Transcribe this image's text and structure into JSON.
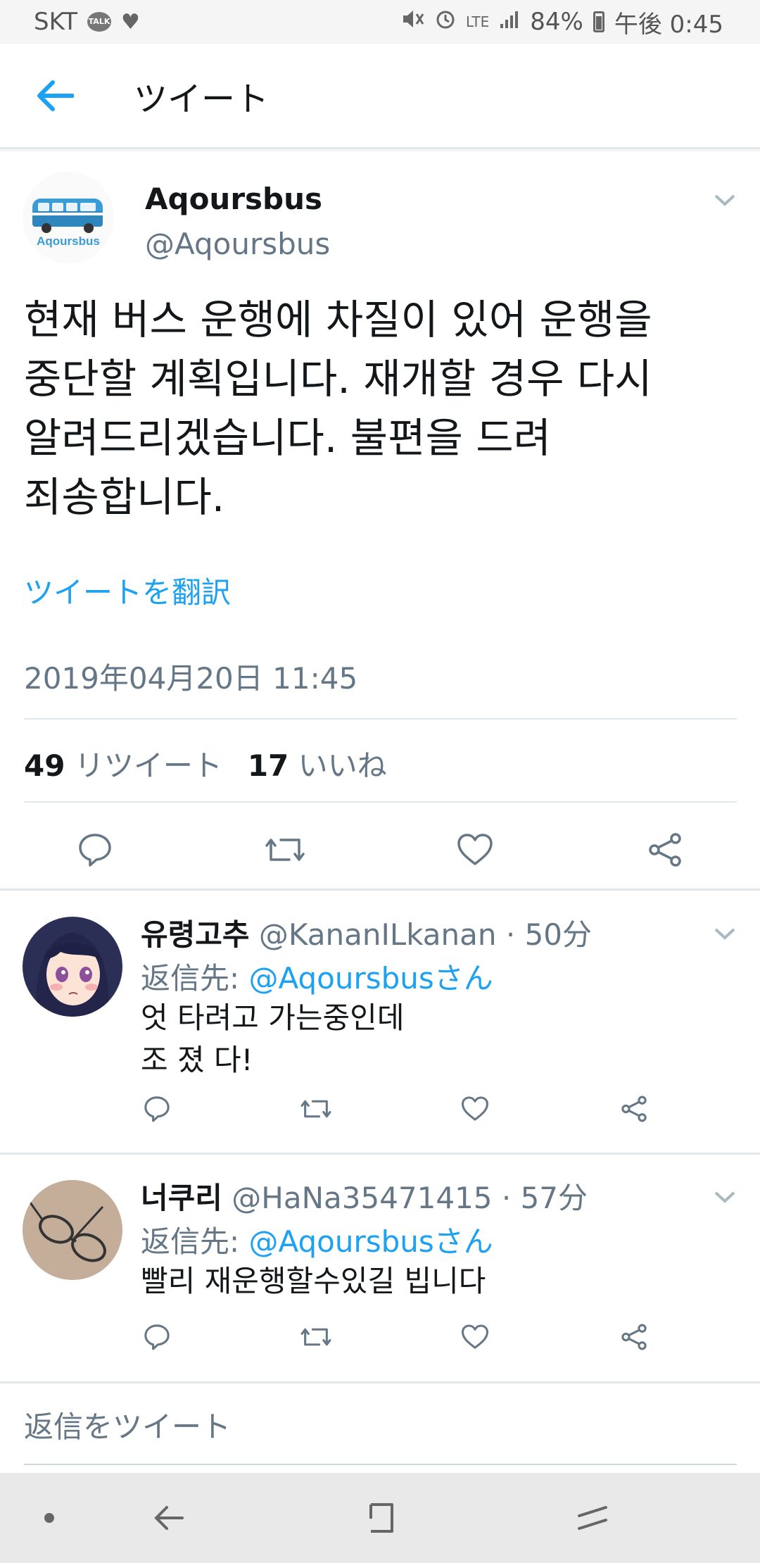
{
  "status_bar": {
    "carrier": "SKT",
    "talk_badge": "TALK",
    "network": "LTE",
    "battery": "84%",
    "time": "午後 0:45"
  },
  "header": {
    "title": "ツイート"
  },
  "tweet": {
    "author_name": "Aqoursbus",
    "author_handle": "@Aqoursbus",
    "avatar_logo_text": "Aqoursbus",
    "text_lines": [
      "현재 버스 운행에 차질이 있어 운행을",
      "중단할 계획입니다. 재개할 경우 다시",
      "알려드리겠습니다. 불편을 드려",
      "죄송합니다."
    ],
    "translate_label": "ツイートを翻訳",
    "timestamp": "2019年04月20日 11:45",
    "retweet_count": "49",
    "retweet_label": "リツイート",
    "like_count": "17",
    "like_label": "いいね"
  },
  "replies": [
    {
      "name": "유령고추",
      "meta": "@KananILkanan · 50分",
      "reply_prefix": "返信先: ",
      "reply_mention": "@Aqoursbusさん",
      "text_lines": [
        "엇 타려고 가는중인데",
        "조 졌 다!"
      ]
    },
    {
      "name": "너쿠리",
      "meta": "@HaNa35471415 · 57分",
      "reply_prefix": "返信先: ",
      "reply_mention": "@Aqoursbusさん",
      "text_lines": [
        "빨리 재운행할수있길 빕니다"
      ]
    }
  ],
  "compose": {
    "placeholder": "返信をツイート"
  },
  "colors": {
    "accent": "#1da1f2",
    "secondary_text": "#657786",
    "divider": "#e1e8ed"
  },
  "icons": [
    "back-arrow-icon",
    "chevron-down-icon",
    "reply-icon",
    "retweet-icon",
    "like-icon",
    "share-icon",
    "nav-dot-icon",
    "nav-back-icon",
    "nav-home-icon",
    "nav-recent-icon"
  ]
}
